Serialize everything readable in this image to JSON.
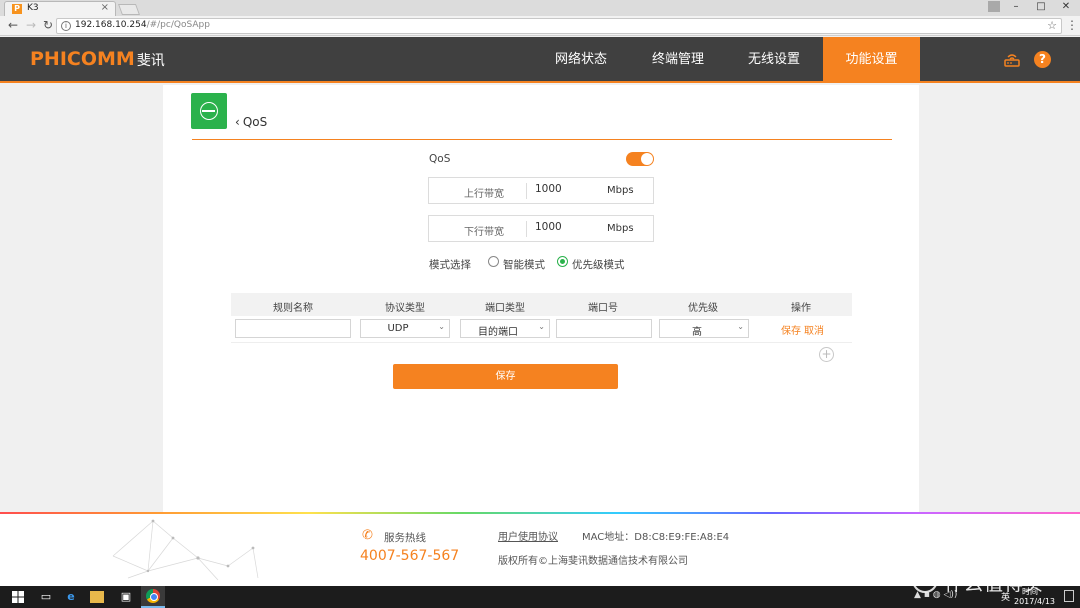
{
  "browser": {
    "tab_title": "K3",
    "tab_favicon": "P",
    "url_host": "192.168.10.254",
    "url_path": "/#/pc/QoSApp"
  },
  "header": {
    "logo_en": "PHICOMM",
    "logo_cn": "斐讯",
    "nav": [
      "网络状态",
      "终端管理",
      "无线设置",
      "功能设置"
    ],
    "active_nav": "功能设置",
    "help_symbol": "?",
    "accent_color": "#f58220",
    "bar_color": "#404040"
  },
  "page": {
    "back_label": "QoS",
    "app_icon": "qos-icon",
    "app_icon_color": "#2bb24c",
    "qos_label": "QoS",
    "qos_enabled": true,
    "upload": {
      "label": "上行带宽",
      "value": "1000",
      "unit": "Mbps"
    },
    "download": {
      "label": "下行带宽",
      "value": "1000",
      "unit": "Mbps"
    },
    "mode": {
      "label": "模式选择",
      "options": [
        "智能模式",
        "优先级模式"
      ],
      "selected": "优先级模式"
    },
    "table": {
      "headers": [
        "规则名称",
        "协议类型",
        "端口类型",
        "端口号",
        "优先级",
        "操作"
      ],
      "row": {
        "name": "",
        "protocol": "UDP",
        "port_type": "目的端口",
        "port": "",
        "priority": "高",
        "save": "保存",
        "cancel": "取消"
      },
      "add_symbol": "+"
    },
    "save_button": "保存"
  },
  "footer": {
    "hotline_label": "服务热线",
    "hotline_number": "4007-567-567",
    "agreement": "用户使用协议",
    "mac": "MAC地址：D8:C8:E9:FE:A8:E4",
    "copyright": "版权所有©上海斐讯数据通信技术有限公司"
  },
  "taskbar": {
    "language": "英",
    "time": "时间",
    "date": "2017/4/13"
  },
  "watermark": {
    "symbol": "值",
    "text": "什么值得买"
  }
}
